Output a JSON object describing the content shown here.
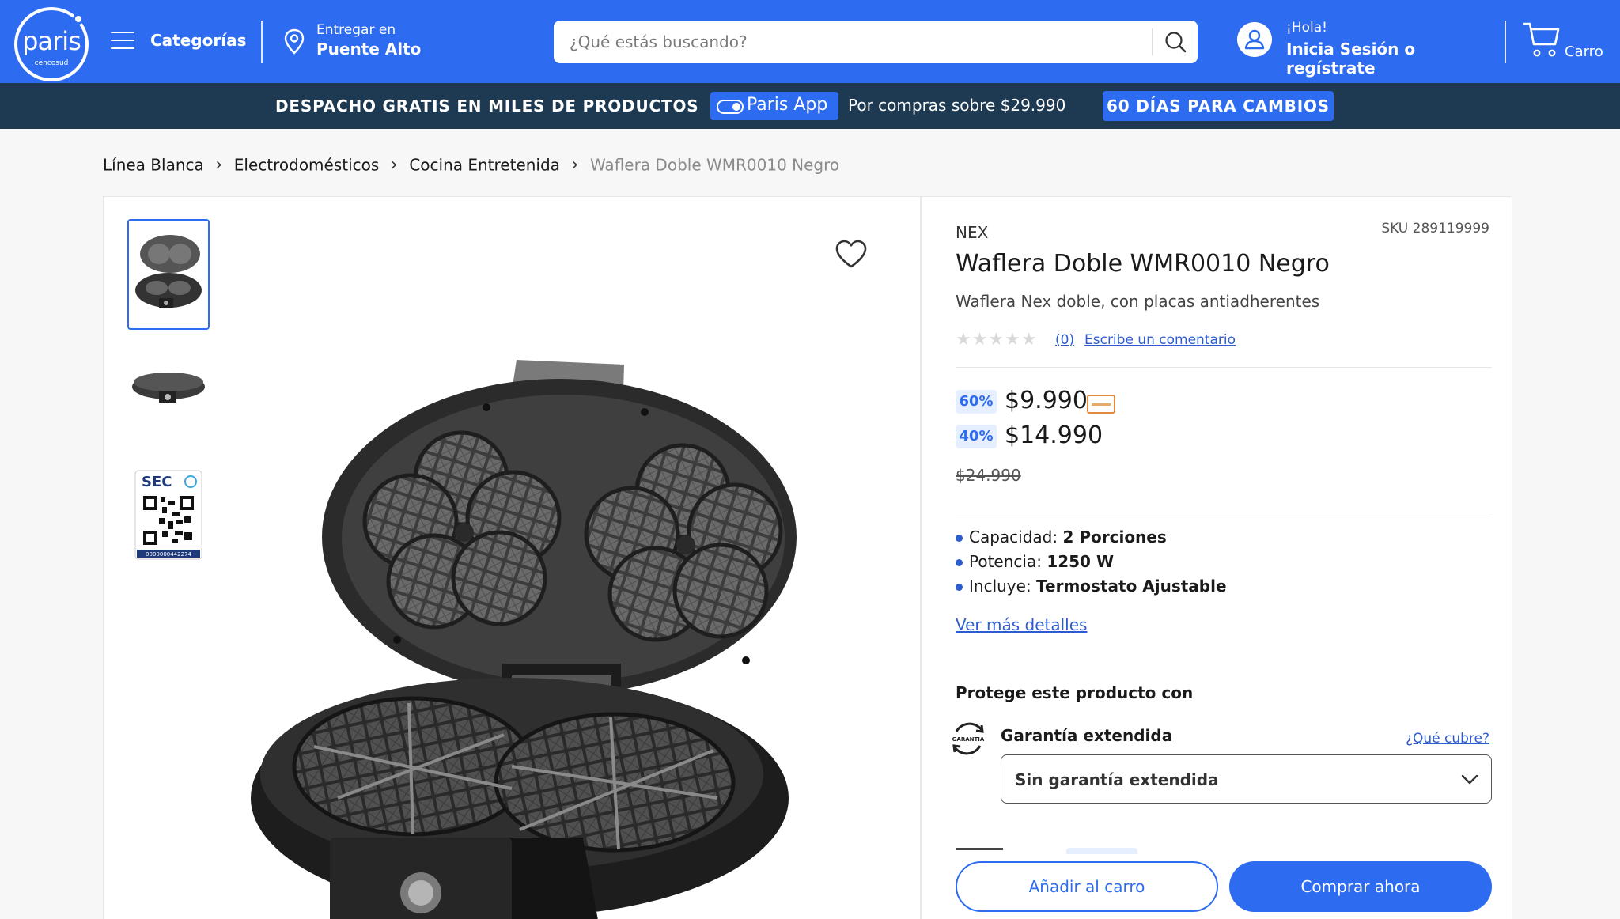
{
  "header": {
    "logo_text": "paris",
    "logo_sub": "cencosud",
    "menu_label": "Categorías",
    "deliver_line1": "Entregar en",
    "deliver_line2": "Puente Alto",
    "search_placeholder": "¿Qué estás buscando?",
    "user_line1": "¡Hola!",
    "user_line2": "Inicia Sesión o regístrate",
    "cart_label": "Carro"
  },
  "promo": {
    "main": "DESPACHO GRATIS EN MILES DE PRODUCTOS",
    "app_label": "Paris App",
    "minimum": "Por compras sobre $29.990",
    "returns": "60 DÍAS PARA CAMBIOS"
  },
  "breadcrumb": [
    "Línea Blanca",
    "Electrodomésticos",
    "Cocina Entretenida",
    "Waflera Doble WMR0010 Negro"
  ],
  "gallery": {
    "thumbnails": [
      "open-waffle-maker",
      "closed-waffle-maker",
      "sec-qr-label"
    ],
    "selected_index": 0,
    "sec_label": "SEC",
    "sec_code": "0000000442274"
  },
  "product": {
    "brand": "NEX",
    "sku": "SKU 289119999",
    "title": "Waflera Doble WMR0010 Negro",
    "subtitle": "Waflera Nex doble, con placas antiadherentes",
    "rating_count": "(0)",
    "review_link": "Escribe un comentario",
    "prices": [
      {
        "badge": "60%",
        "amount": "$9.990",
        "card_icon": true
      },
      {
        "badge": "40%",
        "amount": "$14.990",
        "card_icon": false
      }
    ],
    "old_price": "$24.990",
    "specs": [
      {
        "label": "Capacidad:",
        "value": "2 Porciones"
      },
      {
        "label": "Potencia:",
        "value": "1250 W"
      },
      {
        "label": "Incluye:",
        "value": "Termostato Ajustable"
      }
    ],
    "more_details": "Ver más detalles",
    "protect_title": "Protege este producto con",
    "warranty_icon_text": "GARANTIA",
    "warranty_label": "Garantía extendida",
    "warranty_link": "¿Qué cubre?",
    "warranty_selected": "Sin garantía extendida",
    "add_to_cart": "Añadir al carro",
    "buy_now": "Comprar ahora"
  },
  "colors": {
    "brand_blue": "#2d6cf0",
    "promo_navy": "#1e3a52",
    "link_blue": "#2d5bd0"
  }
}
